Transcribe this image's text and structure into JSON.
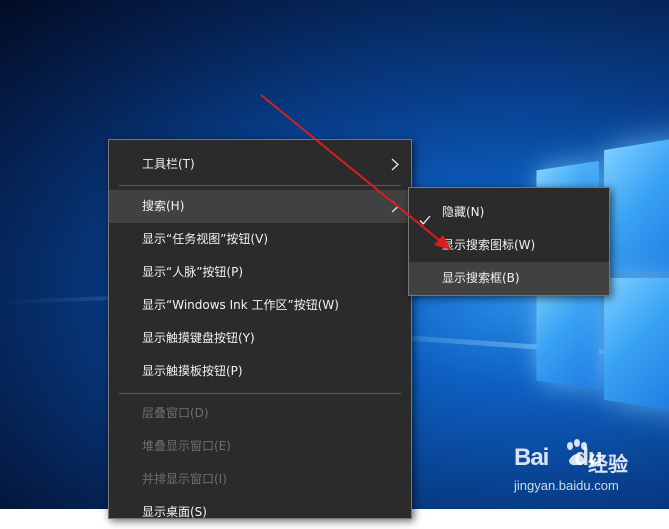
{
  "context_menu": {
    "items": [
      {
        "label": "工具栏(T)",
        "has_submenu": true,
        "state": "normal"
      },
      {
        "label": "搜索(H)",
        "has_submenu": true,
        "state": "highlighted"
      },
      {
        "label": "显示“任务视图”按钮(V)",
        "state": "normal"
      },
      {
        "label": "显示“人脉”按钮(P)",
        "state": "normal"
      },
      {
        "label": "显示“Windows Ink 工作区”按钮(W)",
        "state": "normal"
      },
      {
        "label": "显示触摸键盘按钮(Y)",
        "state": "normal"
      },
      {
        "label": "显示触摸板按钮(P)",
        "state": "normal"
      },
      {
        "label": "层叠窗口(D)",
        "state": "disabled"
      },
      {
        "label": "堆叠显示窗口(E)",
        "state": "disabled"
      },
      {
        "label": "并排显示窗口(I)",
        "state": "disabled"
      },
      {
        "label": "显示桌面(S)",
        "state": "normal"
      }
    ]
  },
  "search_submenu": {
    "items": [
      {
        "label": "隐藏(N)",
        "checked": true
      },
      {
        "label": "显示搜索图标(W)",
        "checked": false
      },
      {
        "label": "显示搜索框(B)",
        "checked": false,
        "state": "highlighted"
      }
    ]
  },
  "annotation": {
    "arrow_color": "#d81e1e"
  },
  "watermark": {
    "brand_left": "Bai",
    "brand_right": "du",
    "product": "经验",
    "url": "jingyan.baidu.com"
  },
  "colors": {
    "menu_bg": "#2b2b2b",
    "menu_hover": "#414141",
    "menu_text": "#f2f2f2",
    "menu_disabled": "#6e6e6e"
  }
}
